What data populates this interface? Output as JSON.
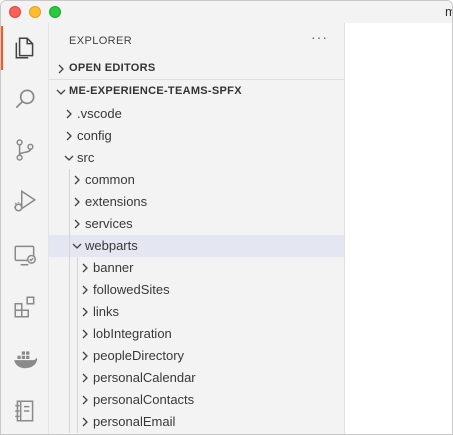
{
  "window": {
    "title": "m"
  },
  "activity_bar": [
    {
      "icon": "files-icon",
      "active": true
    },
    {
      "icon": "search-icon",
      "active": false
    },
    {
      "icon": "source-control-icon",
      "active": false
    },
    {
      "icon": "run-debug-icon",
      "active": false
    },
    {
      "icon": "remote-explorer-icon",
      "active": false
    },
    {
      "icon": "extensions-icon",
      "active": false
    },
    {
      "icon": "docker-icon",
      "active": false
    },
    {
      "icon": "notebook-icon",
      "active": false
    }
  ],
  "sidebar": {
    "title": "EXPLORER",
    "more": "···",
    "open_editors": "OPEN EDITORS",
    "project": "ME-EXPERIENCE-TEAMS-SPFX"
  },
  "tree": [
    {
      "name": ".vscode",
      "depth": 1,
      "expanded": false
    },
    {
      "name": "config",
      "depth": 1,
      "expanded": false
    },
    {
      "name": "src",
      "depth": 1,
      "expanded": true
    },
    {
      "name": "common",
      "depth": 2,
      "expanded": false
    },
    {
      "name": "extensions",
      "depth": 2,
      "expanded": false
    },
    {
      "name": "services",
      "depth": 2,
      "expanded": false
    },
    {
      "name": "webparts",
      "depth": 2,
      "expanded": true,
      "selected": true
    },
    {
      "name": "banner",
      "depth": 3,
      "expanded": false
    },
    {
      "name": "followedSites",
      "depth": 3,
      "expanded": false
    },
    {
      "name": "links",
      "depth": 3,
      "expanded": false
    },
    {
      "name": "lobIntegration",
      "depth": 3,
      "expanded": false
    },
    {
      "name": "peopleDirectory",
      "depth": 3,
      "expanded": false
    },
    {
      "name": "personalCalendar",
      "depth": 3,
      "expanded": false
    },
    {
      "name": "personalContacts",
      "depth": 3,
      "expanded": false
    },
    {
      "name": "personalEmail",
      "depth": 3,
      "expanded": false
    }
  ]
}
